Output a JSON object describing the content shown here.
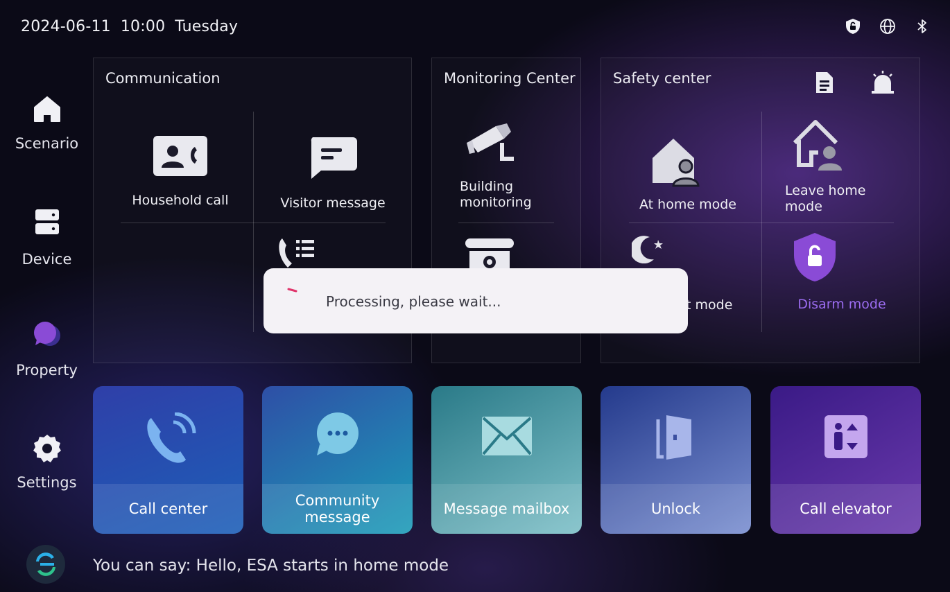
{
  "status": {
    "date": "2024-06-11",
    "time": "10:00",
    "weekday": "Tuesday",
    "icons": [
      "security-shield-icon",
      "globe-icon",
      "bluetooth-icon"
    ]
  },
  "sidebar": {
    "items": [
      {
        "label": "Scenario",
        "icon": "home-icon"
      },
      {
        "label": "Device",
        "icon": "server-icon"
      },
      {
        "label": "Property",
        "icon": "chat-bubbles-icon"
      },
      {
        "label": "Settings",
        "icon": "gear-icon"
      }
    ]
  },
  "communication": {
    "title": "Communication",
    "items": [
      "Household call",
      "Visitor message"
    ]
  },
  "monitoring": {
    "title": "Monitoring Center",
    "items": [
      "Building monitoring"
    ]
  },
  "safety": {
    "title": "Safety center",
    "items": [
      "At home mode",
      "Leave home mode",
      "nt mode",
      "Disarm mode"
    ]
  },
  "tiles": [
    {
      "label": "Call center",
      "color": "#2b4fb6"
    },
    {
      "label": "Community message",
      "color": "#1f8fb0"
    },
    {
      "label": "Message mailbox",
      "color": "#2a8a94"
    },
    {
      "label": "Unlock",
      "color": "#4a63b0"
    },
    {
      "label": "Call elevator",
      "color": "#5b2fa0"
    }
  ],
  "voice": {
    "hint": "You can say: Hello, ESA starts in home mode"
  },
  "dialog": {
    "message": "Processing, please wait..."
  },
  "colors": {
    "accent_purple": "#8a4bd6",
    "disarm_text": "#9b6cf0"
  }
}
